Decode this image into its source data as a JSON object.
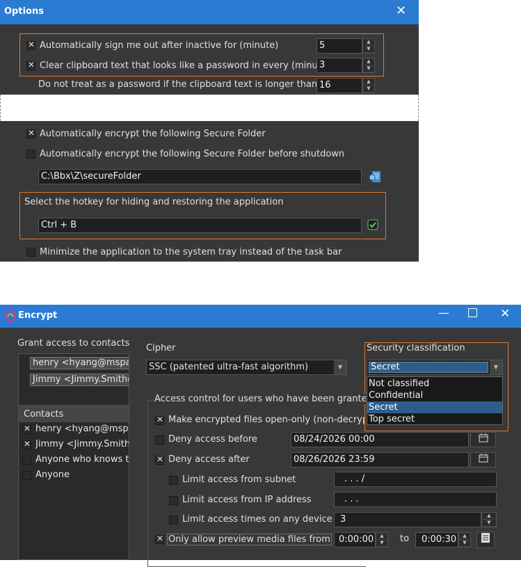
{
  "options": {
    "title": "Options",
    "auto_signout_label": "Automatically sign me out after inactive for (minute)",
    "auto_signout_value": "5",
    "clipboard_clear_label": "Clear clipboard text that looks like a password in every (minute)",
    "clipboard_clear_value": "3",
    "no_treat_label": "Do not treat as a password if the clipboard text is longer than",
    "no_treat_value": "16",
    "auto_encrypt_label": "Automatically encrypt the following Secure Folder",
    "auto_encrypt_shutdown_label": "Automatically encrypt the following Secure Folder before shutdown",
    "secure_folder_path": "C:\\Bbx\\Z\\secureFolder",
    "hotkey_label": "Select the hotkey for hiding and restoring the application",
    "hotkey_value": "Ctrl + B",
    "minimize_tray_label": "Minimize the application to the system tray instead of the task bar"
  },
  "encrypt": {
    "title": "Encrypt",
    "grant_access_label": "Grant access to contacts",
    "granted": [
      "henry <hyang@mspad",
      "Jimmy <Jimmy.Smith@"
    ],
    "contacts_header": "Contacts",
    "contacts": [
      {
        "label": "henry <hyang@mspa",
        "checked": true
      },
      {
        "label": "Jimmy <Jimmy.Smith",
        "checked": true
      },
      {
        "label": "Anyone who knows th",
        "checked": false
      },
      {
        "label": "Anyone",
        "checked": false
      }
    ],
    "cipher_label": "Cipher",
    "cipher_value": "SSC (patented ultra-fast algorithm)",
    "security_label": "Security classification",
    "security_value": "Secret",
    "security_options": [
      "Not classified",
      "Confidential",
      "Secret",
      "Top secret"
    ],
    "access_control_label": "Access control for users who have been granted a",
    "open_only_label": "Make encrypted files open-only (non-decrypta",
    "deny_before_label": "Deny access before",
    "deny_before_value": "08/24/2026 00:00",
    "deny_after_label": "Deny access after",
    "deny_after_value": "08/26/2026 23:59",
    "subnet_label": "Limit access from subnet",
    "subnet_value": ". . . /",
    "ip_label": "Limit access from IP address",
    "ip_value": ". . .",
    "times_label": "Limit access times on any device to",
    "times_value": "3",
    "preview_label": "Only allow preview media files from",
    "preview_from": "0:00:00",
    "to_label": "to",
    "preview_to": "0:00:30"
  },
  "colors": {
    "titlebar": "#2a7bd1",
    "panel": "#383838",
    "accent": "#e2792a",
    "selection": "#2f5d8a"
  }
}
